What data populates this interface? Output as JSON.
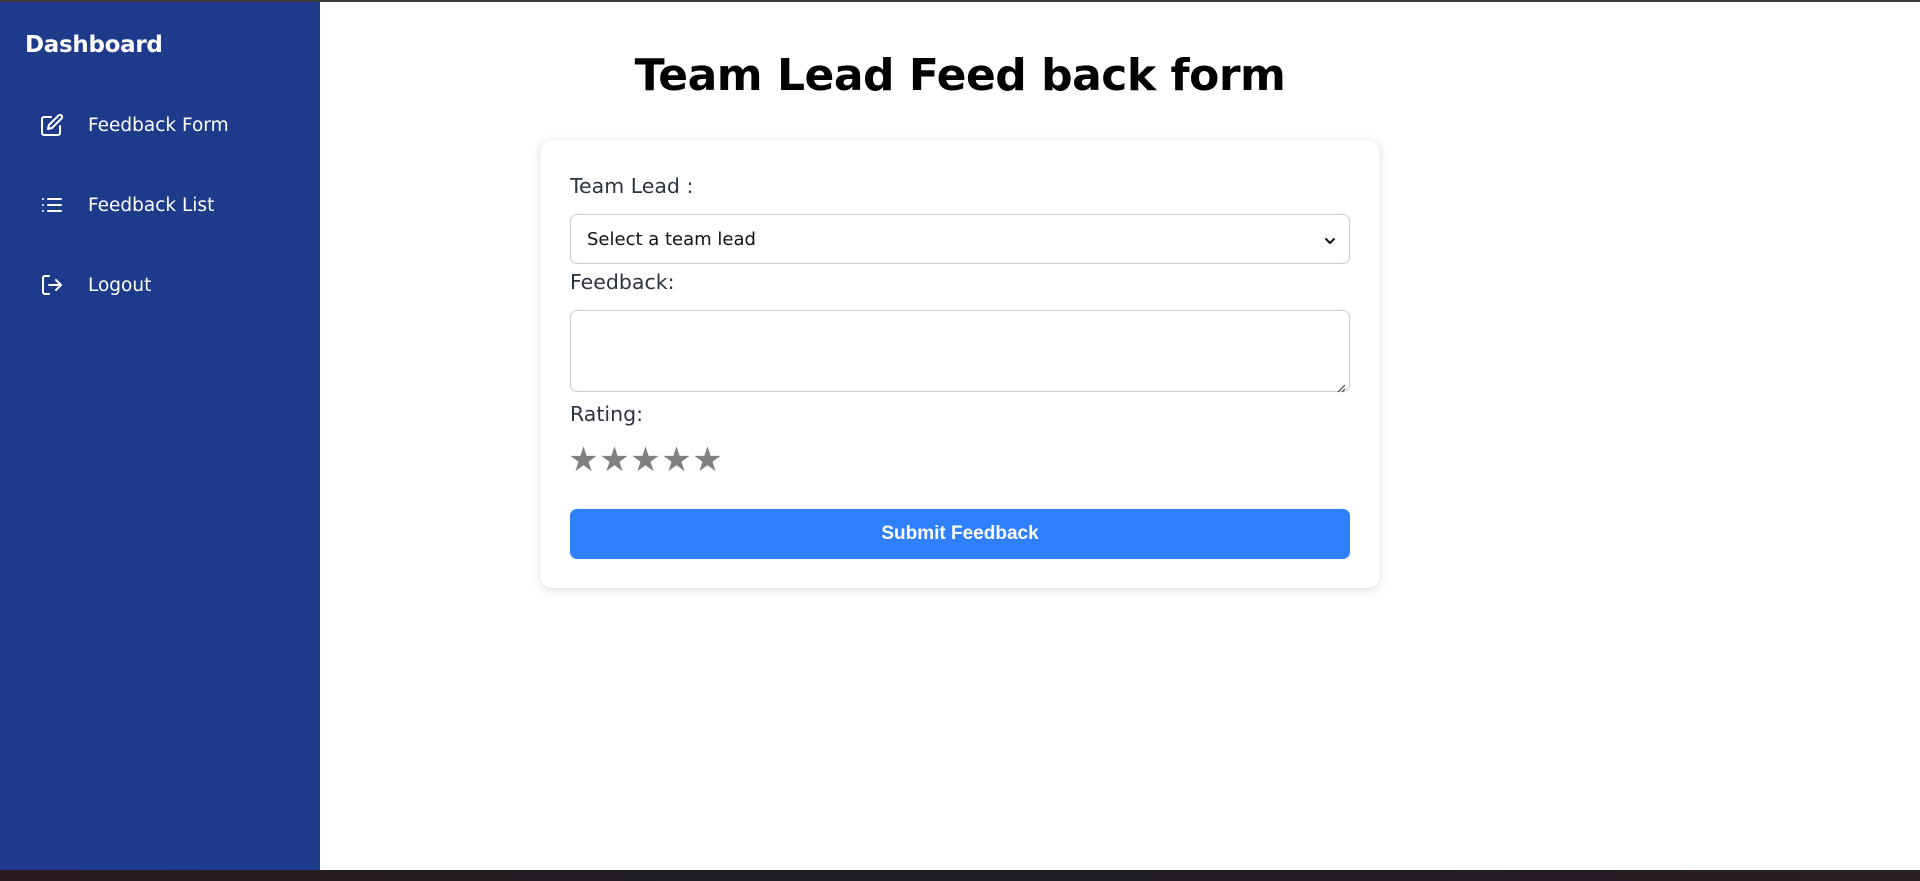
{
  "sidebar": {
    "title": "Dashboard",
    "items": [
      {
        "label": "Feedback Form",
        "icon": "edit-icon"
      },
      {
        "label": "Feedback List",
        "icon": "list-icon"
      },
      {
        "label": "Logout",
        "icon": "logout-icon"
      }
    ]
  },
  "main": {
    "title": "Team Lead Feed back form",
    "form": {
      "team_lead_label": "Team Lead :",
      "team_lead_selected": "Select a team lead",
      "feedback_label": "Feedback:",
      "feedback_value": "",
      "rating_label": "Rating:",
      "rating_max": 5,
      "rating_value": 0,
      "star_glyph": "★",
      "submit_label": "Submit Feedback"
    }
  },
  "colors": {
    "sidebar_bg": "#1e3a8a",
    "button_bg": "#2f80fd",
    "star_inactive": "#808080"
  }
}
